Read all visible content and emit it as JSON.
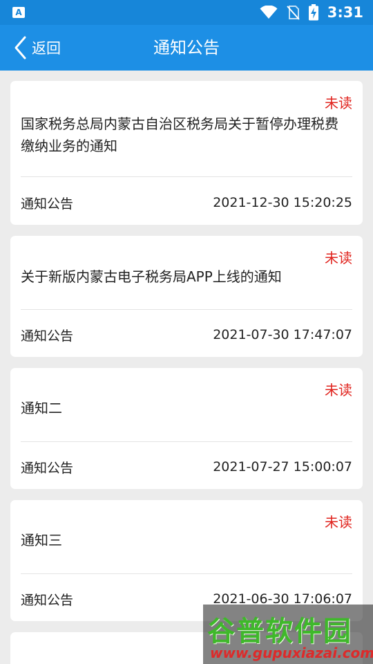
{
  "status_bar": {
    "time": "3:31",
    "icons": [
      "app-notification-icon",
      "wifi-icon",
      "no-sim-icon",
      "battery-charging-icon"
    ]
  },
  "header": {
    "back_label": "返回",
    "title": "通知公告"
  },
  "colors": {
    "header_bg": "#1d8fe5",
    "unread": "#e0231d",
    "page_bg": "#ececec"
  },
  "notices": [
    {
      "status": "未读",
      "title": "国家税务总局内蒙古自治区税务局关于暂停办理税费缴纳业务的通知",
      "category": "通知公告",
      "datetime": "2021-12-30 15:20:25"
    },
    {
      "status": "未读",
      "title": "关于新版内蒙古电子税务局APP上线的通知",
      "category": "通知公告",
      "datetime": "2021-07-30 17:47:07"
    },
    {
      "status": "未读",
      "title": "通知二",
      "category": "通知公告",
      "datetime": "2021-07-27 15:00:07"
    },
    {
      "status": "未读",
      "title": "通知三",
      "category": "通知公告",
      "datetime": "2021-06-30 17:06:07"
    }
  ],
  "watermark": {
    "name": "谷普软件园",
    "url": "www.gupuxiazai.com"
  }
}
